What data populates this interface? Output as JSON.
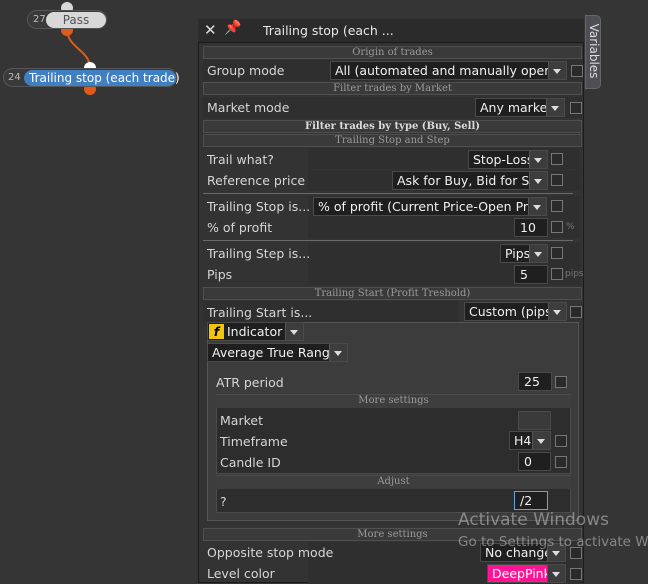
{
  "graph": {
    "node_pass": {
      "number": "27",
      "label": "Pass"
    },
    "node_trailing": {
      "number": "24",
      "label": "Trailing stop (each trade)"
    }
  },
  "panel": {
    "title": "Trailing stop (each ...",
    "side_tab": "Variables",
    "sections": {
      "origin": "Origin of trades",
      "filter_market": "Filter trades by Market",
      "filter_type": "Filter trades by type (Buy, Sell)",
      "trailing_stop_step": "Trailing Stop and Step",
      "trailing_start": "Trailing Start (Profit Treshold)",
      "more_settings_1": "More settings",
      "adjust": "Adjust",
      "more_settings_2": "More settings"
    },
    "fields": {
      "group_mode": {
        "label": "Group mode",
        "value": "All (automated and manually opened)"
      },
      "market_mode": {
        "label": "Market mode",
        "value": "Any market"
      },
      "trail_what": {
        "label": "Trail what?",
        "value": "Stop-Loss"
      },
      "reference_price": {
        "label": "Reference price",
        "value": "Ask for Buy, Bid for Sell"
      },
      "trailing_stop_is": {
        "label": "Trailing Stop is...",
        "value": "% of profit (Current Price-Open Price)"
      },
      "pct_profit": {
        "label": "% of profit",
        "value": "10",
        "unit": "%"
      },
      "trailing_step_is": {
        "label": "Trailing Step is...",
        "value": "Pips"
      },
      "pips": {
        "label": "Pips",
        "value": "5",
        "unit": "pips"
      },
      "trailing_start_is": {
        "label": "Trailing Start is...",
        "value": "Custom (pips)"
      },
      "source_type": {
        "icon": "f",
        "value": "Indicator"
      },
      "indicator": {
        "value": "Average True Range"
      },
      "atr_period": {
        "label": "ATR period",
        "value": "25"
      },
      "market": {
        "label": "Market",
        "value": ""
      },
      "timeframe": {
        "label": "Timeframe",
        "value": "H4"
      },
      "candle_id": {
        "label": "Candle ID",
        "value": "0"
      },
      "adjust": {
        "label": "?",
        "value": "/2"
      },
      "opposite_stop_mode": {
        "label": "Opposite stop mode",
        "value": "No change"
      },
      "level_color": {
        "label": "Level color",
        "value": "DeepPink"
      }
    }
  },
  "watermark": {
    "line1": "Activate Windows",
    "line2": "Go to Settings to activate Wi"
  },
  "colors": {
    "node_selected": "#3f7fc2",
    "node_pass": "#d8d8d8",
    "connector": "#e05a1a",
    "level_color_swatch": "#ff1493"
  }
}
